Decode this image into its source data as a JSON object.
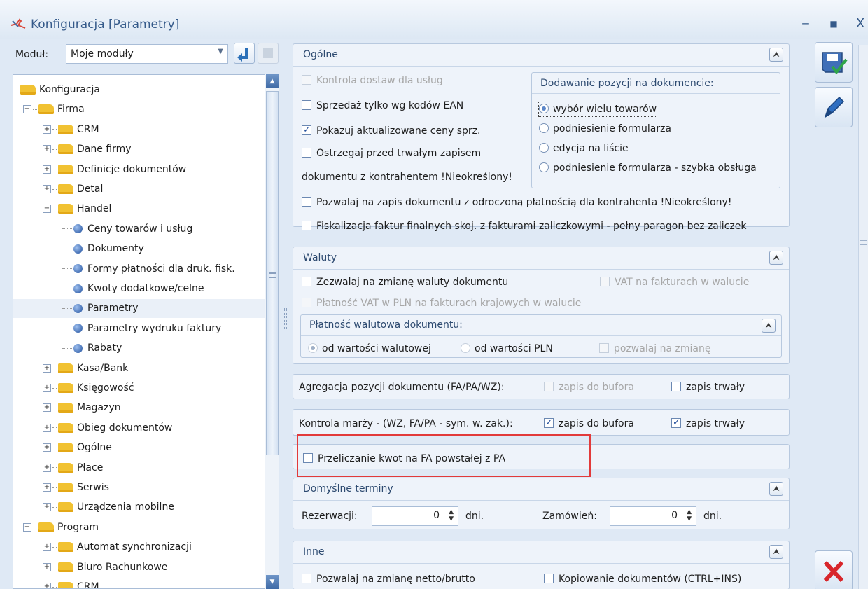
{
  "window": {
    "title": "Konfiguracja [Parametry]",
    "controls": [
      "‒",
      "■",
      "X"
    ]
  },
  "module": {
    "label": "Moduł:",
    "value": "Moje moduły"
  },
  "tree": {
    "items": [
      {
        "label": "Konfiguracja",
        "level": 0,
        "kind": "folder"
      },
      {
        "label": "Firma",
        "level": 1,
        "kind": "folder",
        "exp": "-"
      },
      {
        "label": "CRM",
        "level": 2,
        "kind": "folder",
        "exp": "+"
      },
      {
        "label": "Dane firmy",
        "level": 2,
        "kind": "folder",
        "exp": "+"
      },
      {
        "label": "Definicje dokumentów",
        "level": 2,
        "kind": "folder",
        "exp": "+"
      },
      {
        "label": "Detal",
        "level": 2,
        "kind": "folder",
        "exp": "+"
      },
      {
        "label": "Handel",
        "level": 2,
        "kind": "folder",
        "exp": "-"
      },
      {
        "label": "Ceny towarów i usług",
        "level": 3,
        "kind": "leaf"
      },
      {
        "label": "Dokumenty",
        "level": 3,
        "kind": "leaf"
      },
      {
        "label": "Formy płatności dla druk. fisk.",
        "level": 3,
        "kind": "leaf"
      },
      {
        "label": "Kwoty dodatkowe/celne",
        "level": 3,
        "kind": "leaf"
      },
      {
        "label": "Parametry",
        "level": 3,
        "kind": "leaf",
        "selected": true
      },
      {
        "label": "Parametry wydruku faktury",
        "level": 3,
        "kind": "leaf"
      },
      {
        "label": "Rabaty",
        "level": 3,
        "kind": "leaf"
      },
      {
        "label": "Kasa/Bank",
        "level": 2,
        "kind": "folder",
        "exp": "+"
      },
      {
        "label": "Księgowość",
        "level": 2,
        "kind": "folder",
        "exp": "+"
      },
      {
        "label": "Magazyn",
        "level": 2,
        "kind": "folder",
        "exp": "+"
      },
      {
        "label": "Obieg dokumentów",
        "level": 2,
        "kind": "folder",
        "exp": "+"
      },
      {
        "label": "Ogólne",
        "level": 2,
        "kind": "folder",
        "exp": "+"
      },
      {
        "label": "Płace",
        "level": 2,
        "kind": "folder",
        "exp": "+"
      },
      {
        "label": "Serwis",
        "level": 2,
        "kind": "folder",
        "exp": "+"
      },
      {
        "label": "Urządzenia mobilne",
        "level": 2,
        "kind": "folder",
        "exp": "+"
      },
      {
        "label": "Program",
        "level": 1,
        "kind": "folder",
        "exp": "-"
      },
      {
        "label": "Automat synchronizacji",
        "level": 2,
        "kind": "folder",
        "exp": "+"
      },
      {
        "label": "Biuro Rachunkowe",
        "level": 2,
        "kind": "folder",
        "exp": "+"
      },
      {
        "label": "CRM",
        "level": 2,
        "kind": "folder",
        "exp": "+"
      }
    ]
  },
  "ogolne": {
    "title": "Ogólne",
    "kontrola_dostaw": "Kontrola dostaw dla usług",
    "sprzedaz_ean": "Sprzedaż tylko wg kodów EAN",
    "pokazuj_ceny": "Pokazuj aktualizowane ceny sprz.",
    "ostrzegaj_1": "Ostrzegaj przed trwałym zapisem",
    "ostrzegaj_2": "dokumentu z kontrahentem !Nieokreślony!",
    "pozwalaj_zapis": "Pozwalaj na zapis dokumentu z odroczoną płatnością dla kontrahenta !Nieokreślony!",
    "fiskalizacja": "Fiskalizacja faktur finalnych skoj. z fakturami zaliczkowymi - pełny paragon bez zaliczek",
    "dodawanie": {
      "title": "Dodawanie pozycji na dokumencie:",
      "options": [
        "wybór wielu towarów",
        "podniesienie formularza",
        "edycja na liście",
        "podniesienie formularza - szybka obsługa"
      ]
    }
  },
  "waluty": {
    "title": "Waluty",
    "zezwalaj": "Zezwalaj na zmianę waluty dokumentu",
    "vat_walucie": "VAT na fakturach w walucie",
    "platnosc_vat": "Płatność VAT w PLN na fakturach krajowych w walucie",
    "platnosc_walutowa": {
      "title": "Płatność walutowa dokumentu:",
      "od_walutowej": "od wartości walutowej",
      "od_pln": "od wartości PLN",
      "pozwalaj_zmiane": "pozwalaj na zmianę"
    }
  },
  "agregacja": {
    "label": "Agregacja pozycji dokumentu (FA/PA/WZ):",
    "zapis_bufora": "zapis do bufora",
    "zapis_trwaly": "zapis trwały"
  },
  "kontrola_marzy": {
    "label": "Kontrola marży - (WZ, FA/PA - sym. w. zak.):",
    "zapis_bufora": "zapis do bufora",
    "zapis_trwaly": "zapis trwały"
  },
  "przeliczanie": {
    "label": "Przeliczanie kwot na FA powstałej z PA"
  },
  "terminy": {
    "title": "Domyślne terminy",
    "rezerwacji_label": "Rezerwacji:",
    "rezerwacji_value": "0",
    "zamowien_label": "Zamówień:",
    "zamowien_value": "0",
    "unit": "dni."
  },
  "inne": {
    "title": "Inne",
    "netto_brutto": "Pozwalaj na zmianę netto/brutto",
    "kopiowanie": "Kopiowanie dokumentów (CTRL+INS)"
  },
  "colors": {
    "highlight": "#e23a3a",
    "accent": "#244f9c"
  }
}
